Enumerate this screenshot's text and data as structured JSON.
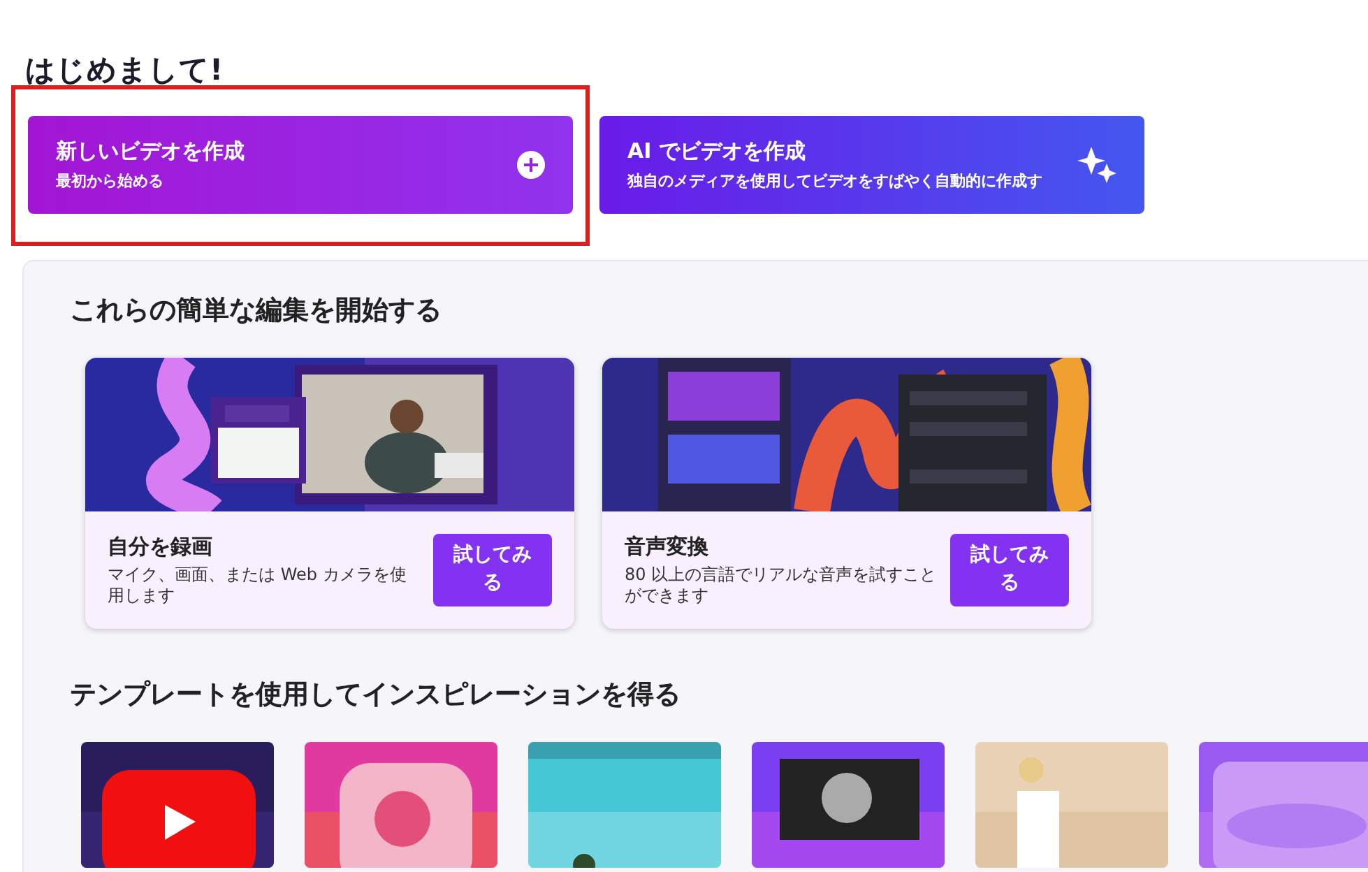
{
  "greeting": "はじめまして!",
  "actions": [
    {
      "kind": "new",
      "title": "新しいビデオを作成",
      "subtitle": "最初から始める",
      "highlighted": true
    },
    {
      "kind": "ai",
      "title": "AI でビデオを作成",
      "subtitle": "独自のメディアを使用してビデオをすばやく自動的に作成す",
      "highlighted": false
    }
  ],
  "edits": {
    "title": "これらの簡単な編集を開始する",
    "cards": [
      {
        "title": "自分を録画",
        "description": "マイク、画面、または Web カメラを使用します",
        "button": "試してみる"
      },
      {
        "title": "音声変換",
        "description": "80 以上の言語でリアルな音声を試すことができます",
        "button": "試してみる"
      }
    ]
  },
  "templates": {
    "title": "テンプレートを使用してインスピレーションを得る"
  }
}
